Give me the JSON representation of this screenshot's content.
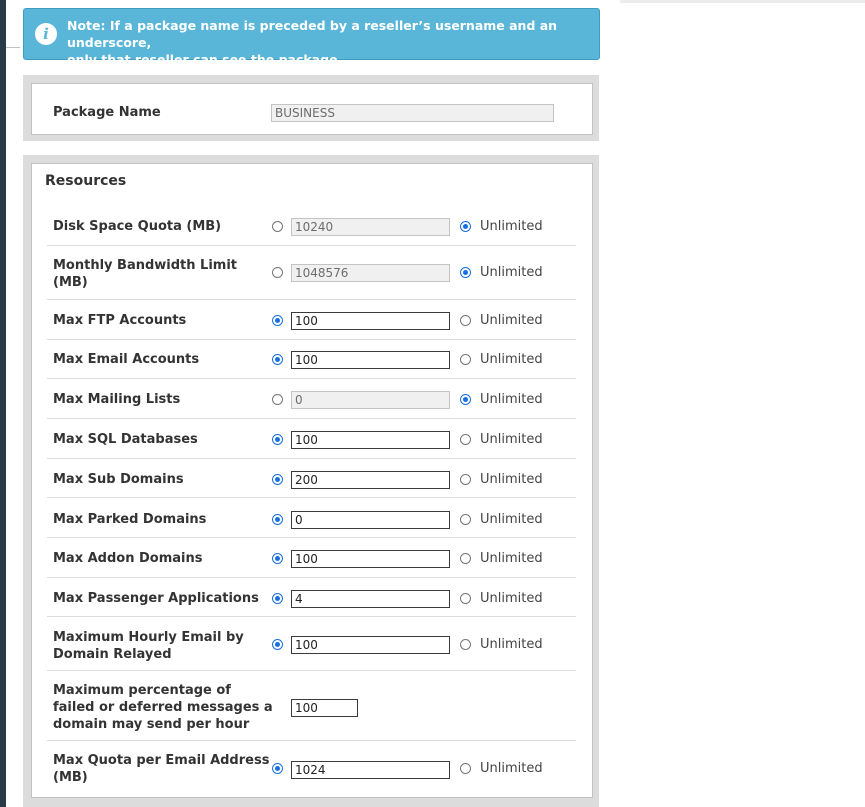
{
  "note": {
    "line1": "Note: If a package name is preceded by a reseller’s username and an underscore,",
    "line2": "only that reseller can see the package."
  },
  "package": {
    "label": "Package Name",
    "value": "BUSINESS"
  },
  "resources": {
    "title": "Resources",
    "unlimited_label": "Unlimited",
    "rows": [
      {
        "label_line1": "Disk Space Quota (MB)",
        "label_line2": "",
        "value": "10240",
        "limited_checked": false,
        "unlimited_checked": true
      },
      {
        "label_line1": "Monthly Bandwidth Limit",
        "label_line2": "(MB)",
        "value": "1048576",
        "limited_checked": false,
        "unlimited_checked": true
      },
      {
        "label_line1": "Max FTP Accounts",
        "label_line2": "",
        "value": "100",
        "limited_checked": true,
        "unlimited_checked": false
      },
      {
        "label_line1": "Max Email Accounts",
        "label_line2": "",
        "value": "100",
        "limited_checked": true,
        "unlimited_checked": false
      },
      {
        "label_line1": "Max Mailing Lists",
        "label_line2": "",
        "value": "0",
        "limited_checked": false,
        "unlimited_checked": true
      },
      {
        "label_line1": "Max SQL Databases",
        "label_line2": "",
        "value": "100",
        "limited_checked": true,
        "unlimited_checked": false
      },
      {
        "label_line1": "Max Sub Domains",
        "label_line2": "",
        "value": "200",
        "limited_checked": true,
        "unlimited_checked": false
      },
      {
        "label_line1": "Max Parked Domains",
        "label_line2": "",
        "value": "0",
        "limited_checked": true,
        "unlimited_checked": false
      },
      {
        "label_line1": "Max Addon Domains",
        "label_line2": "",
        "value": "100",
        "limited_checked": true,
        "unlimited_checked": false
      },
      {
        "label_line1": "Max Passenger Applications",
        "label_line2": "",
        "value": "4",
        "limited_checked": true,
        "unlimited_checked": false
      },
      {
        "label_line1": "Maximum Hourly Email by",
        "label_line2": "Domain Relayed",
        "value": "100",
        "limited_checked": true,
        "unlimited_checked": false
      }
    ],
    "percentage_row": {
      "label_line1": "Maximum percentage of",
      "label_line2": "failed or deferred messages a",
      "label_line3": "domain may send per hour",
      "value": "100"
    },
    "quota_row": {
      "label_line1": "Max Quota per Email Address",
      "label_line2": "(MB)",
      "value": "1024",
      "limited_checked": true,
      "unlimited_checked": false
    }
  }
}
